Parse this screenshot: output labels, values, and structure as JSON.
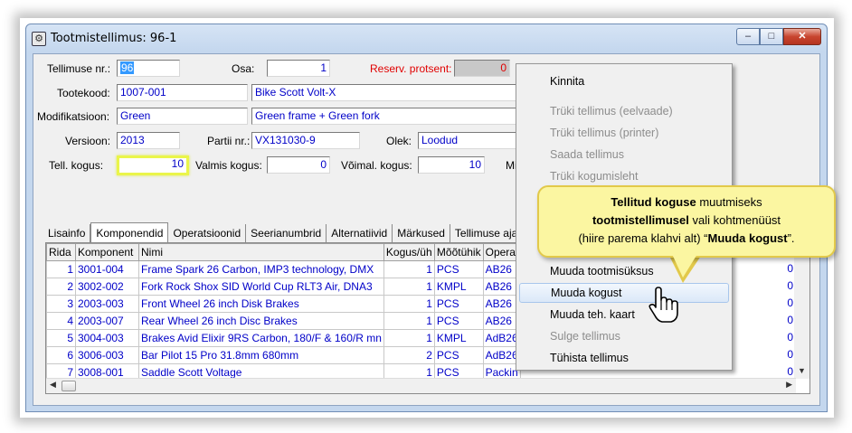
{
  "window": {
    "title": "Tootmistellimus: 96-1",
    "btn_minimize": "–",
    "btn_maximize": "□",
    "btn_close": "✕"
  },
  "form": {
    "order_no_label": "Tellimuse nr.:",
    "order_no": "96",
    "part_label": "Osa:",
    "part": "1",
    "reserve_label": "Reserv. protsent:",
    "reserve": "0",
    "product_code_label": "Tootekood:",
    "product_code": "1007-001",
    "product_name": "Bike Scott Volt-X",
    "modification_label": "Modifikatsioon:",
    "modification": "Green",
    "modification_desc": "Green frame + Green fork",
    "version_label": "Versioon:",
    "version": "2013",
    "batch_label": "Partii nr.:",
    "batch": "VX131030-9",
    "status_label": "Olek:",
    "status": "Loodud",
    "ordered_qty_label": "Tell. kogus:",
    "ordered_qty": "10",
    "finished_qty_label": "Valmis kogus:",
    "finished_qty": "0",
    "possible_qty_label": "Võimal. kogus:",
    "possible_qty": "10",
    "min_label_partial": "Mi"
  },
  "tabs": [
    "Lisainfo",
    "Komponendid",
    "Operatsioonid",
    "Seerianumbrid",
    "Alternatiivid",
    "Märkused",
    "Tellimuse ajalu"
  ],
  "grid": {
    "columns": [
      "Rida",
      "Komponent",
      "Nimi",
      "Kogus/üh",
      "Mõõtühik",
      "Operat"
    ],
    "rows": [
      {
        "rida": "1",
        "komponent": "3001-004",
        "nimi": "Frame Spark 26 Carbon, IMP3 technology, DMX",
        "kogus": "1",
        "uhik": "PCS",
        "operat": "AB26",
        "last": "0"
      },
      {
        "rida": "2",
        "komponent": "3002-002",
        "nimi": "Fork Rock Shox SID World Cup RLT3 Air, DNA3",
        "kogus": "1",
        "uhik": "KMPL",
        "operat": "AB26",
        "last": "0"
      },
      {
        "rida": "3",
        "komponent": "2003-003",
        "nimi": "Front Wheel 26 inch Disk Brakes",
        "kogus": "1",
        "uhik": "PCS",
        "operat": "AB26",
        "last": "0"
      },
      {
        "rida": "4",
        "komponent": "2003-007",
        "nimi": "Rear Wheel 26 inch Disc Brakes",
        "kogus": "1",
        "uhik": "PCS",
        "operat": "AB26",
        "last": "0"
      },
      {
        "rida": "5",
        "komponent": "3004-003",
        "nimi": "Brakes Avid Elixir 9RS Carbon, 180/F & 160/R mn",
        "kogus": "1",
        "uhik": "KMPL",
        "operat": "AdB26",
        "last": "0"
      },
      {
        "rida": "6",
        "komponent": "3006-003",
        "nimi": "Bar Pilot 15 Pro 31.8mm 680mm",
        "kogus": "2",
        "uhik": "PCS",
        "operat": "AdB26",
        "last": "0"
      },
      {
        "rida": "7",
        "komponent": "3008-001",
        "nimi": "Saddle Scott Voltage",
        "kogus": "1",
        "uhik": "PCS",
        "operat": "Packin",
        "last": "0"
      }
    ]
  },
  "context_menu": {
    "items": [
      {
        "label": "Kinnita",
        "disabled": false
      },
      {
        "label": "Trüki tellimus (eelvaade)",
        "disabled": true
      },
      {
        "label": "Trüki tellimus (printer)",
        "disabled": true
      },
      {
        "label": "Saada tellimus",
        "disabled": true
      },
      {
        "label": "Trüki kogumisleht",
        "disabled": true
      },
      {
        "label": "Muuda tootmisüksus",
        "disabled": false
      },
      {
        "label": "Muuda kogust",
        "disabled": false
      },
      {
        "label": "Muuda teh. kaart",
        "disabled": false
      },
      {
        "label": "Sulge tellimus",
        "disabled": true
      },
      {
        "label": "Tühista tellimus",
        "disabled": false
      }
    ]
  },
  "callout": {
    "bold1": "Tellitud koguse",
    "text1": " muutmiseks",
    "bold2": "tootmistellimusel",
    "text2": " vali kohtmenüüst",
    "text3": "(hiire parema klahvi alt) “",
    "bold3": "Muuda kogust",
    "text4": "”."
  },
  "colors": {
    "value_text": "#0000c8",
    "warning_label": "#e00000",
    "highlight_border": "#eaf54a",
    "callout_bg": "#fbf6a1"
  }
}
